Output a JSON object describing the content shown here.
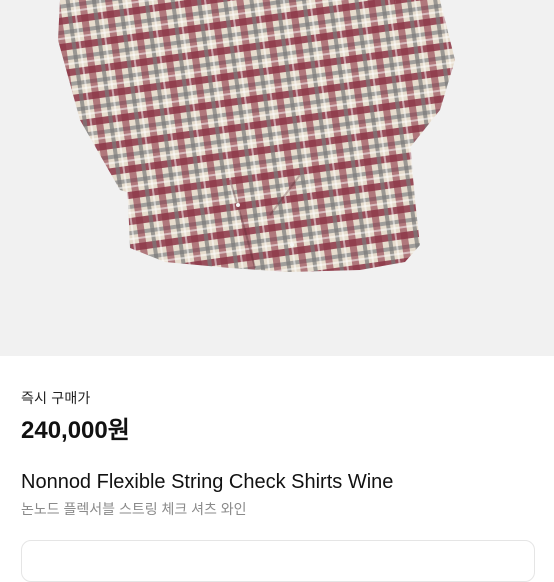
{
  "product": {
    "image_alt": "Plaid check long-sleeve shirt",
    "image_colors": {
      "wine": "#8c3546",
      "gray": "#8f8f8f",
      "cream": "#e6dccd",
      "background": "#f1f1f1"
    },
    "price_label": "즉시 구매가",
    "price": "240,000원",
    "title": "Nonnod Flexible String Check Shirts Wine",
    "subtitle": "논노드 플렉서블 스트링 체크 셔츠 와인"
  }
}
